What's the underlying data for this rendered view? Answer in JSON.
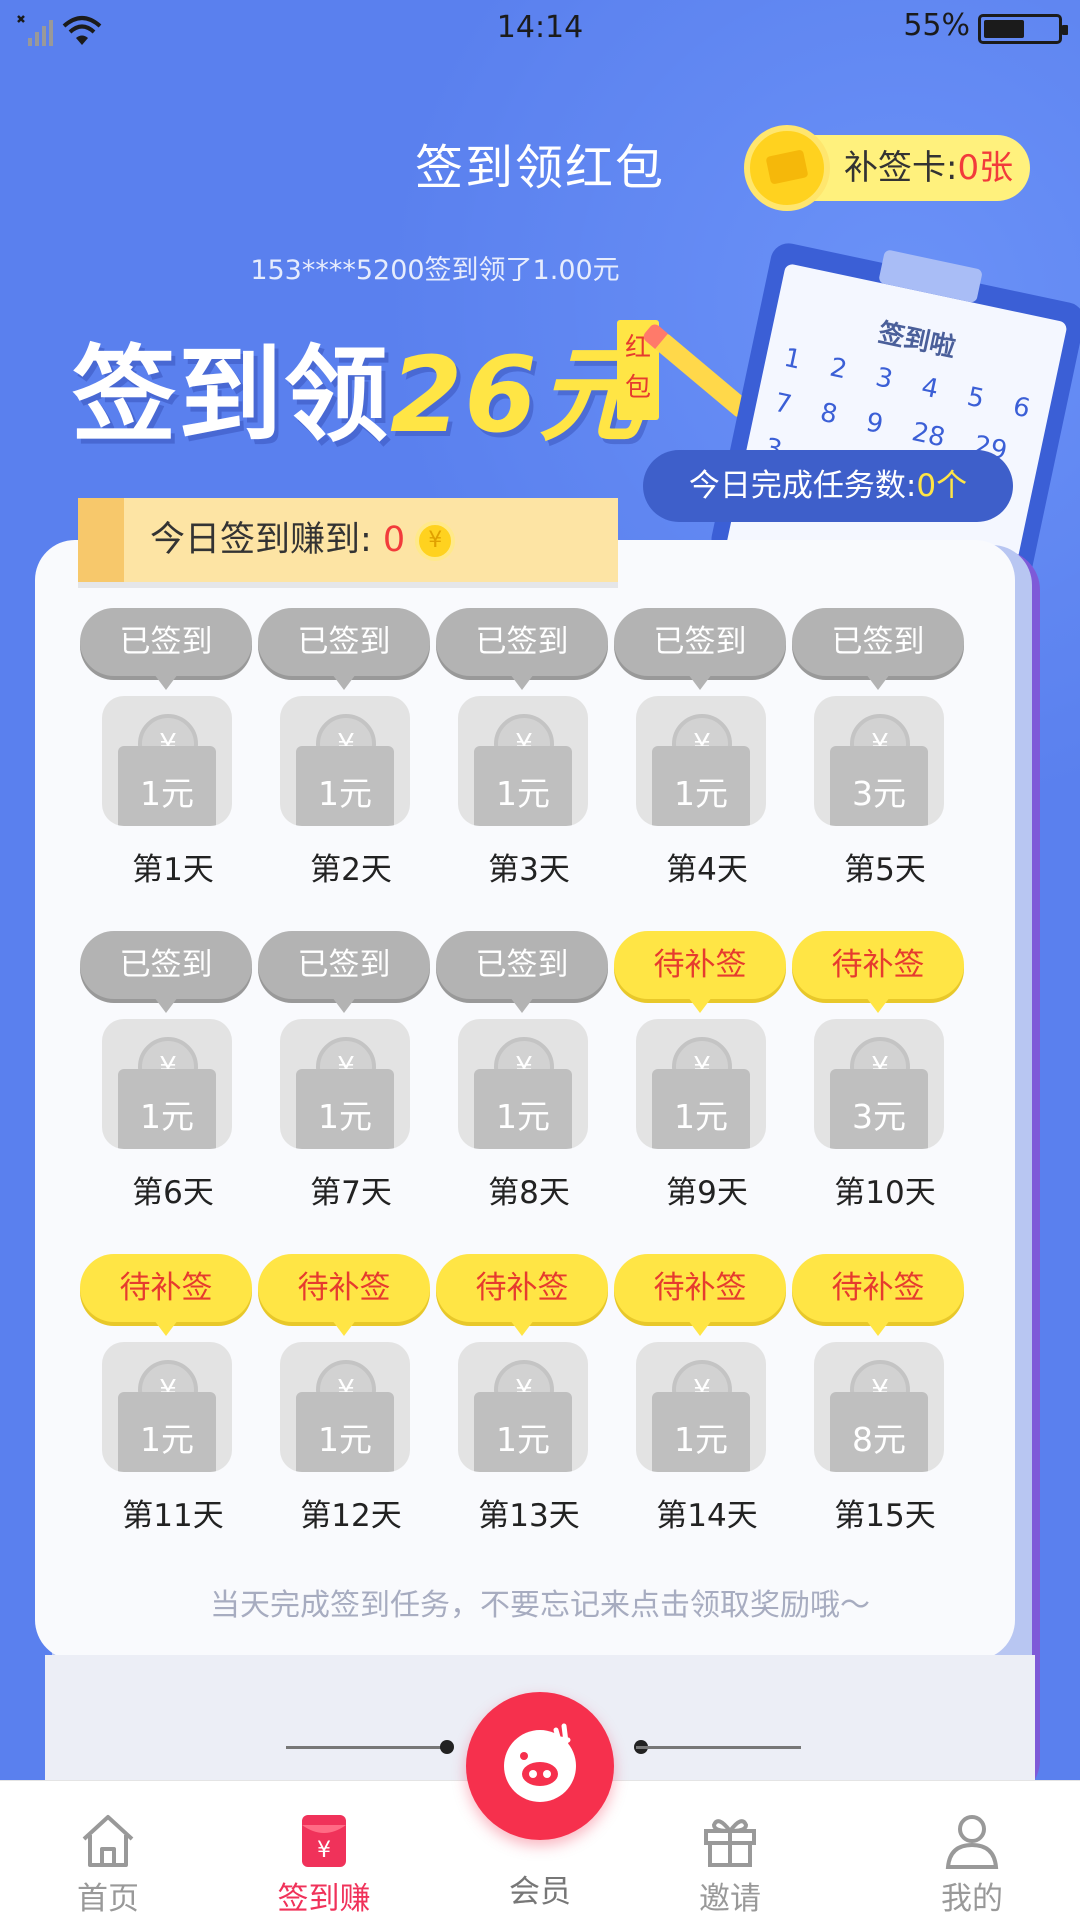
{
  "status_bar": {
    "time": "14:14",
    "battery": "55%",
    "battery_level": 0.55
  },
  "header": {
    "title": "签到领红包",
    "makeup_card_label": "补签卡:",
    "makeup_card_count": "0张",
    "notice": "153****5200签到领了1.00元"
  },
  "banner": {
    "slogan_prefix": "签到领",
    "slogan_amount": "26元",
    "tag": "红包",
    "clipboard_title": "签到啦",
    "clipboard_numbers": "1 2 3 4 5 6 7 8 9 28 29 3"
  },
  "task": {
    "label": "今日完成任务数:",
    "count": "0个"
  },
  "earn": {
    "label": "今日签到赚到: ",
    "value": "0",
    "coin": "¥"
  },
  "days": [
    {
      "status": "已签到",
      "amount": "1元",
      "label": "第1天",
      "state": "signed"
    },
    {
      "status": "已签到",
      "amount": "1元",
      "label": "第2天",
      "state": "signed"
    },
    {
      "status": "已签到",
      "amount": "1元",
      "label": "第3天",
      "state": "signed"
    },
    {
      "status": "已签到",
      "amount": "1元",
      "label": "第4天",
      "state": "signed"
    },
    {
      "status": "已签到",
      "amount": "3元",
      "label": "第5天",
      "state": "signed"
    },
    {
      "status": "已签到",
      "amount": "1元",
      "label": "第6天",
      "state": "signed"
    },
    {
      "status": "已签到",
      "amount": "1元",
      "label": "第7天",
      "state": "signed"
    },
    {
      "status": "已签到",
      "amount": "1元",
      "label": "第8天",
      "state": "signed"
    },
    {
      "status": "待补签",
      "amount": "1元",
      "label": "第9天",
      "state": "pending"
    },
    {
      "status": "待补签",
      "amount": "3元",
      "label": "第10天",
      "state": "pending"
    },
    {
      "status": "待补签",
      "amount": "1元",
      "label": "第11天",
      "state": "pending"
    },
    {
      "status": "待补签",
      "amount": "1元",
      "label": "第12天",
      "state": "pending"
    },
    {
      "status": "待补签",
      "amount": "1元",
      "label": "第13天",
      "state": "pending"
    },
    {
      "status": "待补签",
      "amount": "1元",
      "label": "第14天",
      "state": "pending"
    },
    {
      "status": "待补签",
      "amount": "8元",
      "label": "第15天",
      "state": "pending"
    }
  ],
  "coin_symbol": "¥",
  "tip": "当天完成签到任务，不要忘记来点击领取奖励哦～",
  "tabs": [
    {
      "label": "首页",
      "icon": "home-icon",
      "active": false
    },
    {
      "label": "签到赚",
      "icon": "red-envelope-icon",
      "active": true
    },
    {
      "label": "会员",
      "icon": "pig-icon",
      "active": false
    },
    {
      "label": "邀请",
      "icon": "gift-icon",
      "active": false
    },
    {
      "label": "我的",
      "icon": "user-icon",
      "active": false
    }
  ],
  "colors": {
    "accent": "#f0325a",
    "background": "#5a82ef",
    "pending": "#ffe545",
    "signed": "#b3b3b3"
  }
}
